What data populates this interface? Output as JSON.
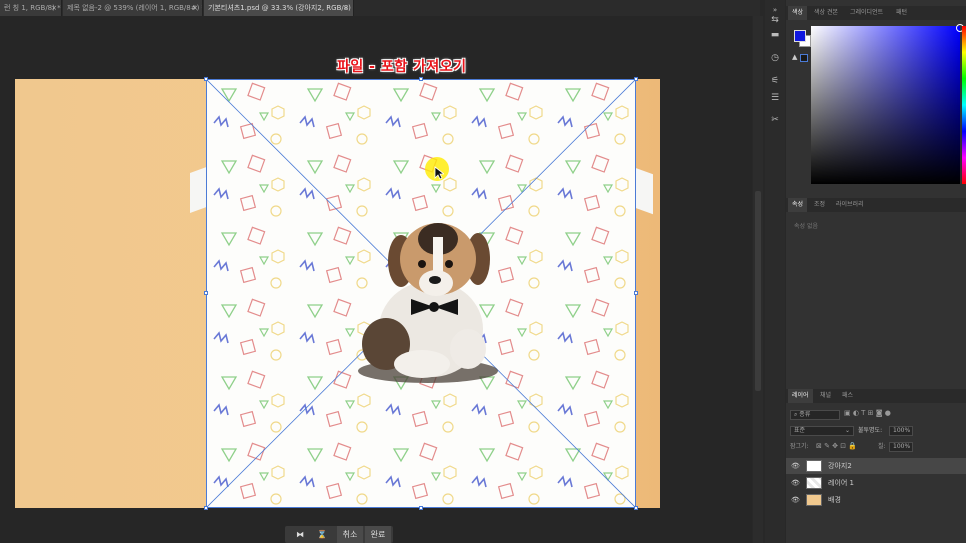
{
  "tabs": [
    {
      "label": "런 칭 1, RGB/8) *",
      "close": "×",
      "active": false
    },
    {
      "label": "제목 없음-2 @ 539% (레이어 1, RGB/8#) *",
      "close": "×",
      "active": false
    },
    {
      "label": "기본티셔츠1.psd @ 33.3% (강아지2, RGB/8)",
      "close": "×",
      "active": true
    }
  ],
  "canvas": {
    "banner_text": "파일 - 포함 가져오기"
  },
  "transform_bar": {
    "btn1_icon": "interpolation-icon",
    "btn2_icon": "warp-icon",
    "cancel": "취소",
    "commit": "완료"
  },
  "color_panel": {
    "tabs": [
      "색상",
      "색상 견본",
      "그레이디언트",
      "패턴"
    ],
    "fg_color": "#1018e0",
    "bg_color": "#ffffff"
  },
  "properties_panel": {
    "tabs": [
      "속성",
      "조정",
      "라이브러리"
    ],
    "empty_text": "속성 없음"
  },
  "layers_panel": {
    "tabs": [
      "레이어",
      "채널",
      "패스"
    ],
    "filter_placeholder": "종류",
    "blend_mode": "표준",
    "opacity_label": "불투명도:",
    "opacity_value": "100%",
    "lock_label": "잠그기:",
    "fill_label": "칠:",
    "fill_value": "100%",
    "layers": [
      {
        "name": "강아지2",
        "selected": true,
        "type": "smart"
      },
      {
        "name": "레이어 1",
        "selected": false,
        "type": "pattern"
      },
      {
        "name": "배경",
        "selected": false,
        "type": "background"
      }
    ]
  }
}
